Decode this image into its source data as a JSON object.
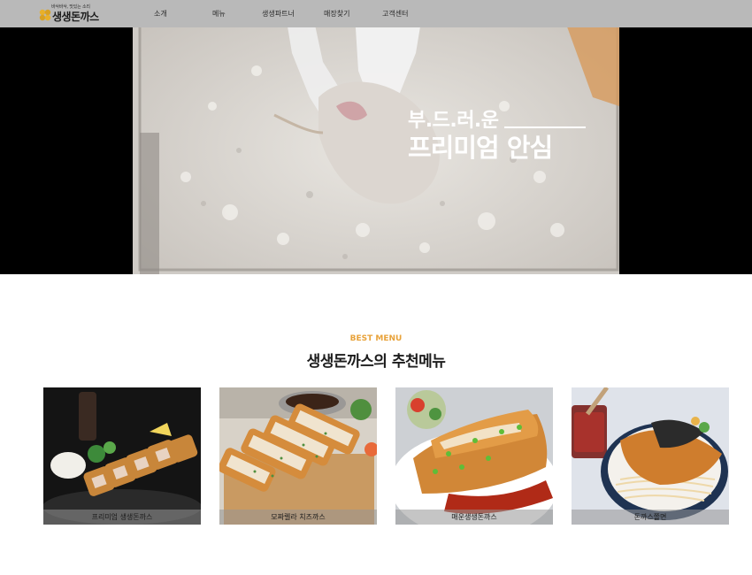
{
  "header": {
    "logo": {
      "slogan": "바삭바삭, 맛있는 소리",
      "brand": "생생돈까스"
    },
    "nav": [
      {
        "label": "소개"
      },
      {
        "label": "메뉴"
      },
      {
        "label": "생생파트너"
      },
      {
        "label": "매장찾기"
      },
      {
        "label": "고객센터"
      }
    ]
  },
  "hero": {
    "caption_line1": "부.드.러.운",
    "caption_line2": "프리미엄 안심"
  },
  "best": {
    "label": "BEST MENU",
    "title": "생생돈까스의 추천메뉴",
    "items": [
      {
        "name": "프리미엄 생생돈까스"
      },
      {
        "name": "모짜렐라 치즈까스"
      },
      {
        "name": "매운생생돈까스"
      },
      {
        "name": "돈까스쫄면"
      }
    ]
  },
  "colors": {
    "accent": "#e8a23a",
    "nav_bg": "#b9b9b9"
  }
}
